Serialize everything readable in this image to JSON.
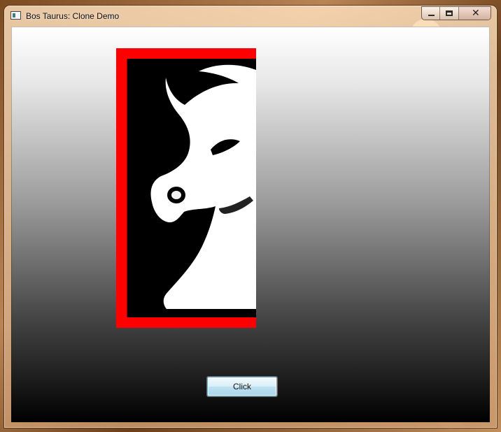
{
  "window": {
    "title": "Bos Taurus: Clone Demo",
    "controls": {
      "minimize": "minimize-window",
      "maximize": "maximize-window",
      "close": "close-window"
    }
  },
  "content": {
    "image": {
      "subject": "bull",
      "border_color": "#ff0000",
      "background_color": "#000000"
    },
    "button": {
      "label": "Click"
    }
  },
  "colors": {
    "gradient_top": "#ffffff",
    "gradient_bottom": "#000000",
    "button_accent": "#6aa8c6"
  }
}
